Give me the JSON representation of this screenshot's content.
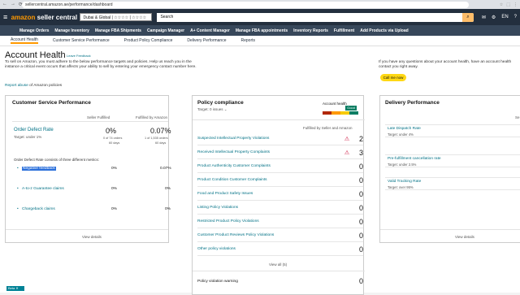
{
  "browser": {
    "url": "sellercentral.amazon.ae/performance/dashboard"
  },
  "topbar": {
    "logo_a": "amazon",
    "logo_b": "seller central",
    "account_selector": "Dubai & Global | ☆☆☆☆ | ☆☆☆☆",
    "search_label": "Search"
  },
  "nav": {
    "items": [
      "Manage Orders",
      "Manage Inventory",
      "Manage FBA Shipments",
      "Campaign Manager",
      "A+ Content Manager",
      "Manage FBA appointments",
      "Inventory Reports",
      "Fulfillment",
      "Add Products via Upload"
    ]
  },
  "subtabs": [
    "Account Health",
    "Customer Service Performance",
    "Product Policy Compliance",
    "Delivery Performance",
    "Reports"
  ],
  "page": {
    "title": "Account Health",
    "feedback": "Leave Feedback",
    "intro": "To sell on Amazon, you must adhere to the below performance targets and policies. Help us reach you in the instance a critical event occurs that affects your ability to sell by entering your emergency contact number here.",
    "report_link": "Report abuse",
    "report_suffix": " of Amazon policies",
    "right_note": "If you have any questions about your account health, have an account health contact you right away.",
    "call_btn": "Call me now",
    "bottom_tag": "Beta"
  },
  "csp": {
    "title": "Customer Service Performance",
    "col_seller": "Seller Fulfilled",
    "col_amazon": "Fulfilled by Amazon",
    "odr_label": "Order Defect Rate",
    "odr_target": "Target: under 1%",
    "odr_seller": "0%",
    "odr_seller_sub": "0 of 74 orders",
    "odr_seller_days": "60 days",
    "odr_amazon": "0.07%",
    "odr_amazon_sub": "1 of 1,535 orders",
    "odr_amazon_days": "60 days",
    "metrics_note": "Order Defect Rate consists of three different metrics:",
    "metrics": [
      {
        "label": "Negative feedback",
        "seller": "0%",
        "amazon": "0.07%"
      },
      {
        "label": "A-to-z Guarantee claims",
        "seller": "0%",
        "amazon": "0%"
      },
      {
        "label": "Chargeback claims",
        "seller": "0%",
        "amazon": "0%"
      }
    ],
    "view": "View details"
  },
  "pc": {
    "title": "Policy compliance",
    "target": "Target: 0 issues",
    "health_label": "Account health",
    "health_status": "Good",
    "col_header": "Fulfilled by Seller and Amazon",
    "rows": [
      {
        "label": "Suspected Intellectual Property Violations",
        "value": "2",
        "warn": true
      },
      {
        "label": "Received Intellectual Property Complaints",
        "value": "3",
        "warn": true
      },
      {
        "label": "Product Authenticity Customer Complaints",
        "value": "0",
        "warn": false
      },
      {
        "label": "Product Condition Customer Complaints",
        "value": "0",
        "warn": false
      },
      {
        "label": "Food and Product Safety Issues",
        "value": "0",
        "warn": false
      },
      {
        "label": "Listing Policy Violations",
        "value": "0",
        "warn": false
      },
      {
        "label": "Restricted Product Policy Violations",
        "value": "0",
        "warn": false
      },
      {
        "label": "Customer Product Reviews Policy Violations",
        "value": "0",
        "warn": false
      },
      {
        "label": "Other policy violations",
        "value": "0",
        "warn": false
      }
    ],
    "view_all": "View all (5)",
    "warning_label": "Policy violation warning",
    "warning_value": "0",
    "colors": {
      "red": "#b12704",
      "orange": "#ff9900",
      "yellow": "#f7ca00",
      "green": "#067d62"
    }
  },
  "dp": {
    "title": "Delivery Performance",
    "col_right": "Se",
    "rows": [
      {
        "label": "Late Dispatch Rate",
        "target": "Target: under 4%"
      },
      {
        "label": "Pre-fulfillment cancellation rate",
        "target": "Target: under 2.5%"
      },
      {
        "label": "Valid Tracking Rate",
        "target": "Target: over 95%"
      }
    ],
    "view": "View details"
  }
}
